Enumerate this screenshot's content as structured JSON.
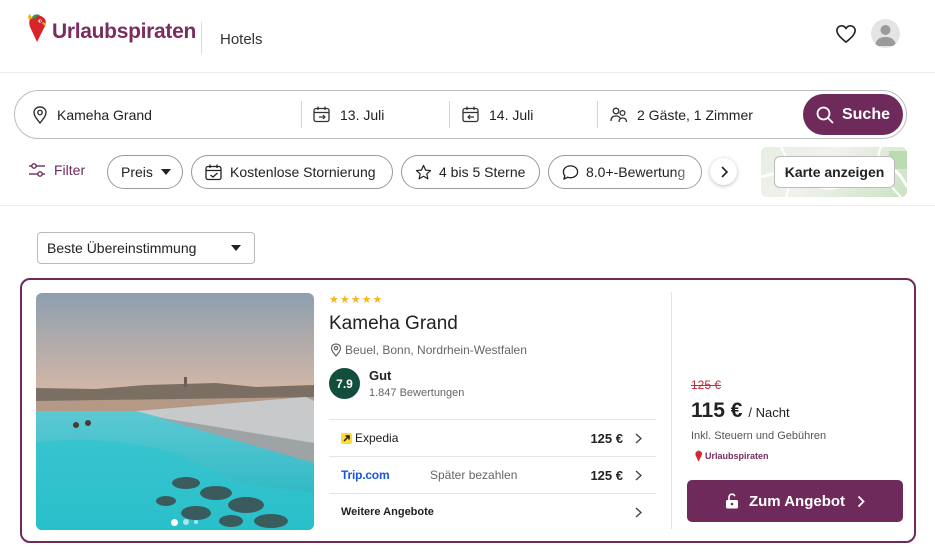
{
  "header": {
    "brand": "Urlaubspiraten",
    "nav_hotels": "Hotels"
  },
  "search": {
    "destination": "Kameha Grand",
    "checkin": "13. Juli",
    "checkout": "14. Juli",
    "guests": "2 Gäste, 1 Zimmer",
    "button": "Suche"
  },
  "filters": {
    "filter_label": "Filter",
    "chips": [
      "Preis",
      "Kostenlose Stornierung",
      "4 bis 5 Sterne",
      "8.0+-Bewertung"
    ],
    "map_button": "Karte anzeigen"
  },
  "sort": {
    "selected": "Beste Übereinstimmung"
  },
  "hotel": {
    "stars": 5,
    "name": "Kameha Grand",
    "location": "Beuel, Bonn, Nordrhein-Westfalen",
    "rating": "7.9",
    "rating_word": "Gut",
    "rating_count": "1.847 Bewertungen",
    "photo_count": 4,
    "photo_active": 1,
    "offers": [
      {
        "provider": "Expedia",
        "note": "",
        "price": "125 €"
      },
      {
        "provider": "Trip.com",
        "note": "Später bezahlen",
        "price": "125 €"
      }
    ],
    "more_offers": "Weitere Angebote",
    "old_price": "125 €",
    "price": "115 €",
    "per_night": "/ Nacht",
    "tax_note": "Inkl. Steuern und Gebühren",
    "partner": "Urlaubspiraten",
    "cta": "Zum Angebot"
  },
  "colors": {
    "brand": "#6e2a5a",
    "rating": "#124e3e",
    "strike": "#c0283e",
    "stars": "#f5b81c"
  }
}
